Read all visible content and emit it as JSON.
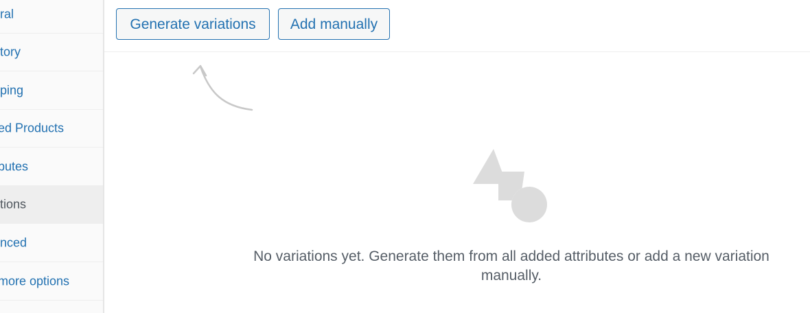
{
  "sidebar": {
    "items": [
      {
        "label": "ral",
        "active": false
      },
      {
        "label": "tory",
        "active": false
      },
      {
        "label": "ping",
        "active": false
      },
      {
        "label": "ed Products",
        "active": false
      },
      {
        "label": "butes",
        "active": false
      },
      {
        "label": "tions",
        "active": true
      },
      {
        "label": "nced",
        "active": false
      },
      {
        "label": "more options",
        "active": false
      }
    ]
  },
  "toolbar": {
    "generate_label": "Generate variations",
    "add_manually_label": "Add manually"
  },
  "empty_state": {
    "message": "No variations yet. Generate them from all added attributes or add a new variation manually."
  },
  "colors": {
    "link": "#2271b1",
    "muted_text": "#555d66",
    "illustration": "#dcdcdc",
    "sidebar_bg": "#fafafa",
    "sidebar_active_bg": "#eeeeee"
  }
}
